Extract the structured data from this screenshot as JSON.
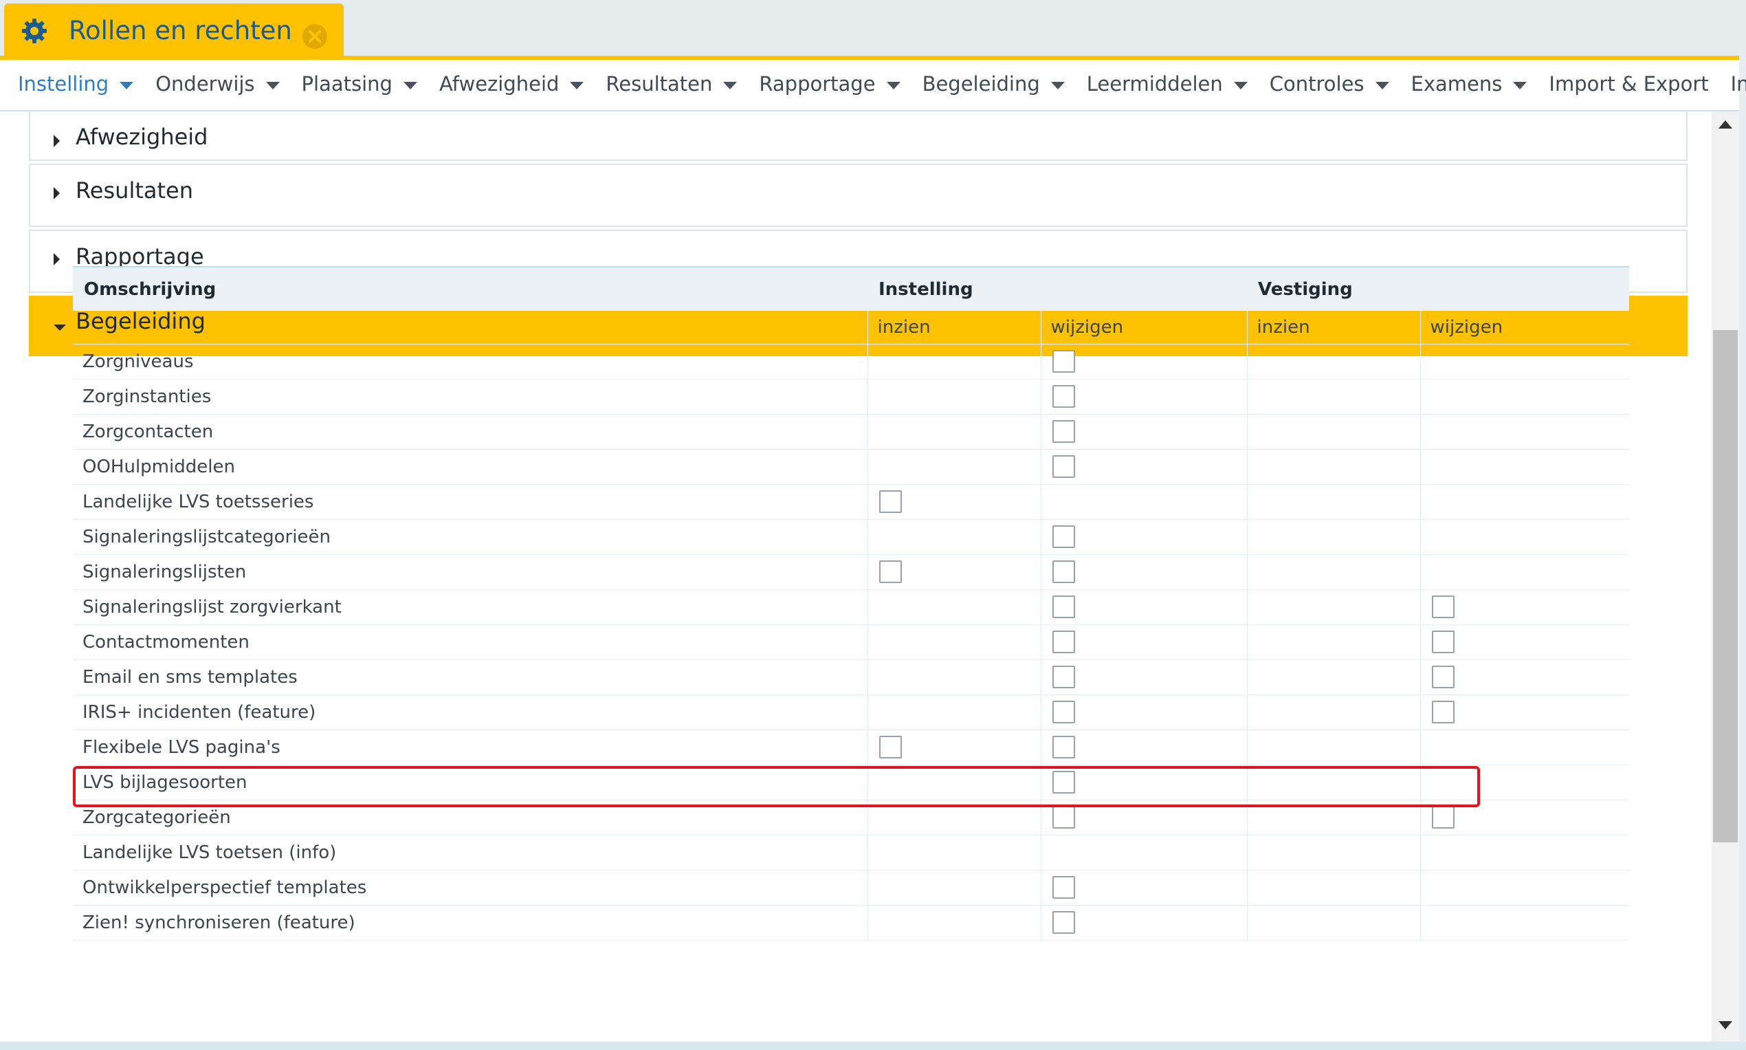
{
  "app": {
    "title": "Rollen en rechten",
    "icons": {
      "settings": "gear-icon",
      "close": "close-circle-icon"
    },
    "accent_color": "#fec200",
    "title_color": "#1b5c8e"
  },
  "menu": [
    {
      "label": "Instelling",
      "caret": true,
      "active": true
    },
    {
      "label": "Onderwijs",
      "caret": true
    },
    {
      "label": "Plaatsing",
      "caret": true
    },
    {
      "label": "Afwezigheid",
      "caret": true
    },
    {
      "label": "Resultaten",
      "caret": true
    },
    {
      "label": "Rapportage",
      "caret": true
    },
    {
      "label": "Begeleiding",
      "caret": true
    },
    {
      "label": "Leermiddelen",
      "caret": true
    },
    {
      "label": "Controles",
      "caret": true
    },
    {
      "label": "Examens",
      "caret": true
    },
    {
      "label": "Import & Export",
      "caret": false
    },
    {
      "label": "Info",
      "caret": false
    }
  ],
  "sections": [
    {
      "label": "Afwezigheid",
      "expanded": false
    },
    {
      "label": "Resultaten",
      "expanded": false
    },
    {
      "label": "Rapportage",
      "expanded": false
    },
    {
      "label": "Begeleiding",
      "expanded": true
    }
  ],
  "table": {
    "headers": {
      "description": "Omschrijving",
      "group1": "Instelling",
      "group2": "Vestiging"
    },
    "subheaders": [
      "inzien",
      "wijzigen",
      "inzien",
      "wijzigen"
    ],
    "rows": [
      {
        "label": "Zorgniveaus",
        "checks": [
          false,
          true,
          false,
          false
        ]
      },
      {
        "label": "Zorginstanties",
        "checks": [
          false,
          true,
          false,
          false
        ]
      },
      {
        "label": "Zorgcontacten",
        "checks": [
          false,
          true,
          false,
          false
        ]
      },
      {
        "label": "OOHulpmiddelen",
        "checks": [
          false,
          true,
          false,
          false
        ]
      },
      {
        "label": "Landelijke LVS toetsseries",
        "checks": [
          true,
          false,
          false,
          false
        ]
      },
      {
        "label": "Signaleringslijstcategorieën",
        "checks": [
          false,
          true,
          false,
          false
        ]
      },
      {
        "label": "Signaleringslijsten",
        "checks": [
          true,
          true,
          false,
          false
        ]
      },
      {
        "label": "Signaleringslijst zorgvierkant",
        "checks": [
          false,
          true,
          false,
          true
        ]
      },
      {
        "label": "Contactmomenten",
        "checks": [
          false,
          true,
          false,
          true
        ]
      },
      {
        "label": "Email en sms templates",
        "checks": [
          false,
          true,
          false,
          true
        ],
        "highlighted": true
      },
      {
        "label": "IRIS+ incidenten (feature)",
        "checks": [
          false,
          true,
          false,
          true
        ]
      },
      {
        "label": "Flexibele LVS pagina's",
        "checks": [
          true,
          true,
          false,
          false
        ]
      },
      {
        "label": "LVS bijlagesoorten",
        "checks": [
          false,
          true,
          false,
          false
        ]
      },
      {
        "label": "Zorgcategorieën",
        "checks": [
          false,
          true,
          false,
          true
        ]
      },
      {
        "label": "Landelijke LVS toetsen (info)",
        "checks": [
          false,
          false,
          false,
          false
        ]
      },
      {
        "label": "Ontwikkelperspectief templates",
        "checks": [
          false,
          true,
          false,
          false
        ]
      },
      {
        "label": "Zien! synchroniseren (feature)",
        "checks": [
          false,
          true,
          false,
          false
        ]
      }
    ]
  }
}
